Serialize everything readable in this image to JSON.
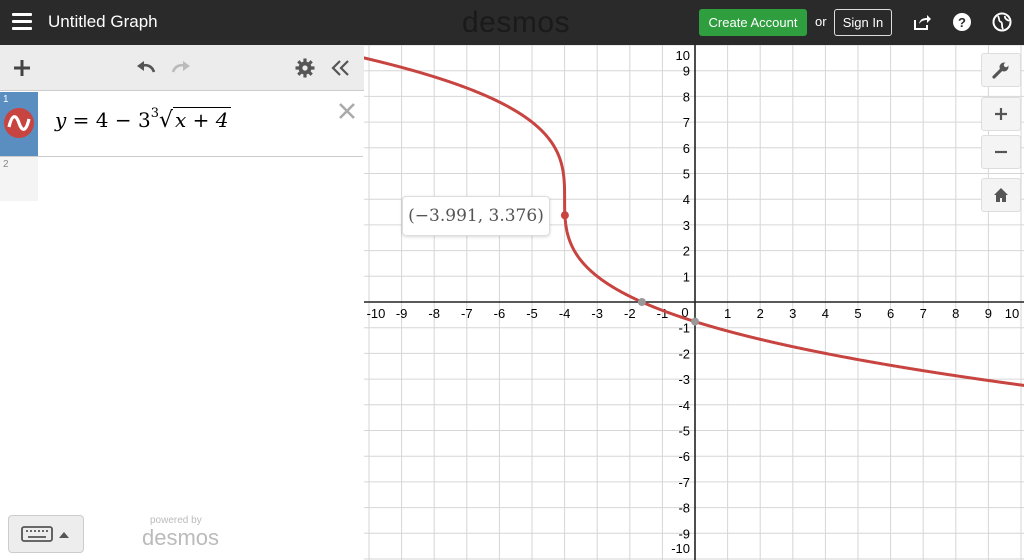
{
  "header": {
    "title": "Untitled Graph",
    "brand": "desmos",
    "create_account": "Create Account",
    "or": "or",
    "sign_in": "Sign In"
  },
  "expressions": [
    {
      "index": "1",
      "latex_parts": {
        "lhs": "y",
        "eq": " = 4 − 3",
        "root_index": "3",
        "radicand": "x + 4"
      },
      "color": "#c74440"
    },
    {
      "index": "2"
    }
  ],
  "footer": {
    "powered_by": "powered by",
    "brand": "desmos"
  },
  "point_label": "(−3.991, 3.376)",
  "graph": {
    "x_range": [
      -10,
      10
    ],
    "y_range": [
      -10,
      10
    ],
    "x_ticks": [
      "-10",
      "-9",
      "-8",
      "-7",
      "-6",
      "-5",
      "-4",
      "-3",
      "-2",
      "-1",
      "0",
      "1",
      "2",
      "3",
      "4",
      "5",
      "6",
      "7",
      "8",
      "9",
      "10"
    ],
    "y_ticks": [
      "10",
      "9",
      "8",
      "7",
      "6",
      "5",
      "4",
      "3",
      "2",
      "1",
      "-1",
      "-2",
      "-3",
      "-4",
      "-5",
      "-6",
      "-7",
      "-8",
      "-9",
      "-10"
    ],
    "curve_color": "#c74440",
    "point": {
      "x": -3.991,
      "y": 3.376
    }
  },
  "icons": [
    "menu-icon",
    "share-icon",
    "help-icon",
    "globe-icon",
    "add-icon",
    "undo-icon",
    "redo-icon",
    "gear-icon",
    "collapse-icon",
    "close-icon",
    "wrench-icon",
    "zoom-in-icon",
    "zoom-out-icon",
    "home-icon",
    "keyboard-icon"
  ]
}
